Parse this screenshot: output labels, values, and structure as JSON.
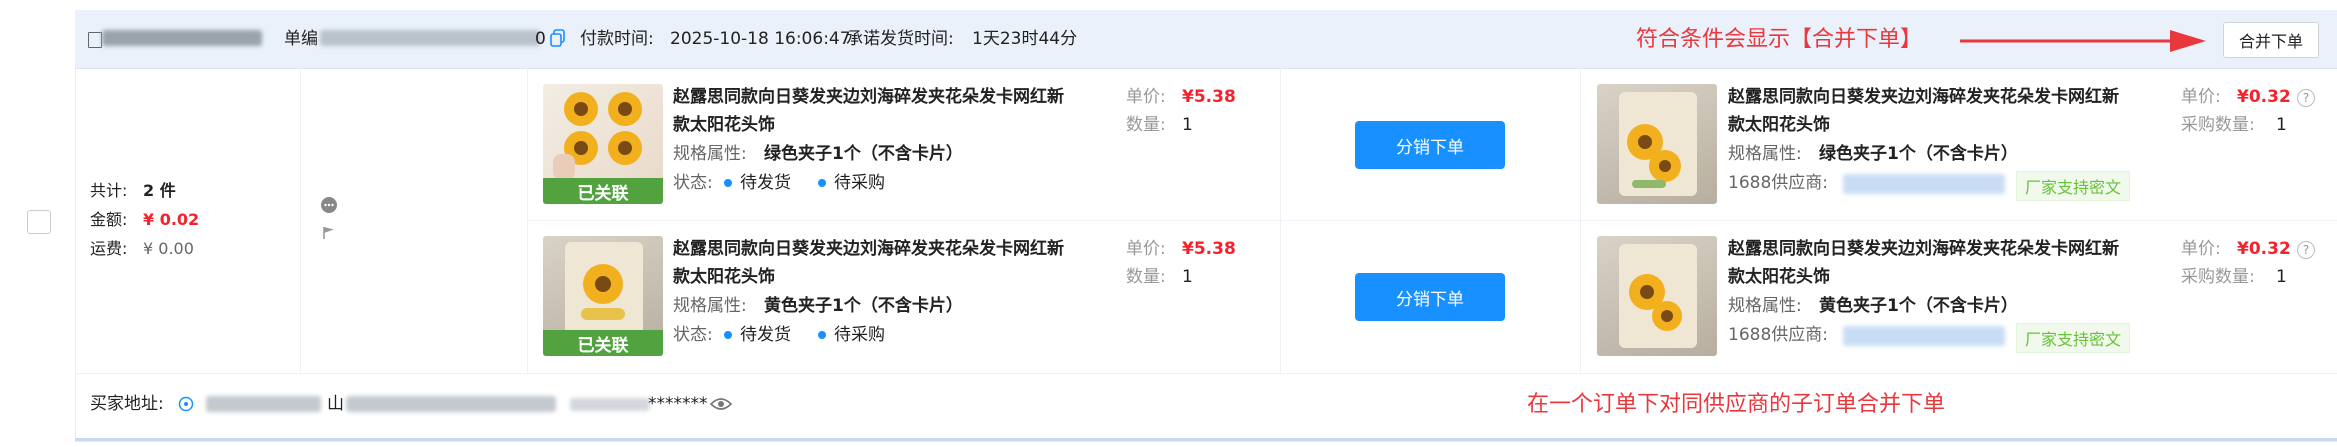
{
  "header": {
    "order_label": "单编",
    "pay_time_label": "付款时间:",
    "pay_time_value": "2025-10-18 16:06:47",
    "ship_promise_label": "承诺发货时间:",
    "ship_promise_value": "1天23时44分",
    "merge_button": "合并下单",
    "order_tail": "0"
  },
  "annotations": {
    "top_note": "符合条件会显示【合并下单】",
    "bottom_note": "在一个订单下对同供应商的子订单合并下单"
  },
  "summary": {
    "total_label": "共计:",
    "total_count": "2 件",
    "amount_label": "金额:",
    "amount_value": "¥ 0.02",
    "shipping_label": "运费:",
    "shipping_value": "¥ 0.00"
  },
  "items": [
    {
      "title_line1": "赵露思同款向日葵发夹边刘海碎发夹花朵发卡网红新",
      "title_line2": "款太阳花头饰",
      "spec_label": "规格属性:",
      "spec_value": "绿色夹子1个（不含卡片）",
      "status_label": "状态:",
      "status1": "待发货",
      "status2": "待采购",
      "price_label": "单价:",
      "price_value": "¥5.38",
      "qty_label": "数量:",
      "qty_value": "1",
      "linked_tag": "已关联",
      "action_button": "分销下单",
      "supplier": {
        "title_line1": "赵露思同款向日葵发夹边刘海碎发夹花朵发卡网红新",
        "title_line2": "款太阳花头饰",
        "spec_label": "规格属性:",
        "spec_value": "绿色夹子1个（不含卡片）",
        "supplier_label": "1688供应商:",
        "badge": "厂家支持密文",
        "price_label": "单价:",
        "price_value": "¥0.32",
        "qty_label": "采购数量:",
        "qty_value": "1"
      }
    },
    {
      "title_line1": "赵露思同款向日葵发夹边刘海碎发夹花朵发卡网红新",
      "title_line2": "款太阳花头饰",
      "spec_label": "规格属性:",
      "spec_value": "黄色夹子1个（不含卡片）",
      "status_label": "状态:",
      "status1": "待发货",
      "status2": "待采购",
      "price_label": "单价:",
      "price_value": "¥5.38",
      "qty_label": "数量:",
      "qty_value": "1",
      "linked_tag": "已关联",
      "action_button": "分销下单",
      "supplier": {
        "title_line1": "赵露思同款向日葵发夹边刘海碎发夹花朵发卡网红新",
        "title_line2": "款太阳花头饰",
        "spec_label": "规格属性:",
        "spec_value": "黄色夹子1个（不含卡片）",
        "supplier_label": "1688供应商:",
        "badge": "厂家支持密文",
        "price_label": "单价:",
        "price_value": "¥0.32",
        "qty_label": "采购数量:",
        "qty_value": "1"
      }
    }
  ],
  "address": {
    "label": "买家地址:",
    "masked": "*******",
    "address_char": "山"
  },
  "colors": {
    "accent": "#1890ff",
    "price_red": "#f5222d",
    "annotation_red": "#e8383d",
    "linked_green": "#52a340",
    "header_bg": "#eaf1fb"
  },
  "icons": [
    "copy-icon",
    "comment-icon",
    "flag-icon",
    "location-icon",
    "eye-icon",
    "help-icon",
    "arrow-icon"
  ]
}
